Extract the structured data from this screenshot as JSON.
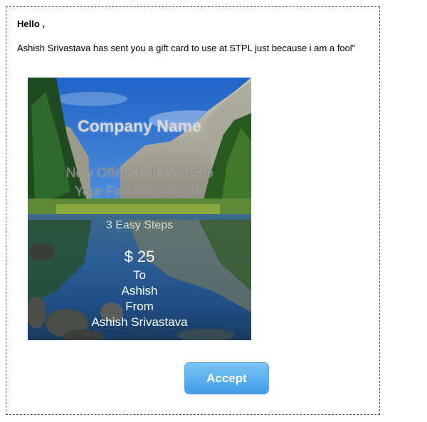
{
  "email": {
    "greeting": "Hello ,",
    "message": "Ashish Srivastava has sent you a gift card to use at STPL just because i am a fool\""
  },
  "gift_card": {
    "company_name": "Company Name",
    "offer_line1": "Now Offers Gift Cards to",
    "offer_line2": "Your Favorite People!",
    "steps_text": "3 Easy Steps",
    "amount": "$ 25",
    "to_label": "To",
    "recipient": "Ashish",
    "from_label": "From",
    "sender": "Ashish Srivastava",
    "background_image": "mountain-lake-landscape"
  },
  "actions": {
    "accept_label": "Accept"
  },
  "colors": {
    "accept_button": "#4aa6ec",
    "border": "#555555"
  }
}
